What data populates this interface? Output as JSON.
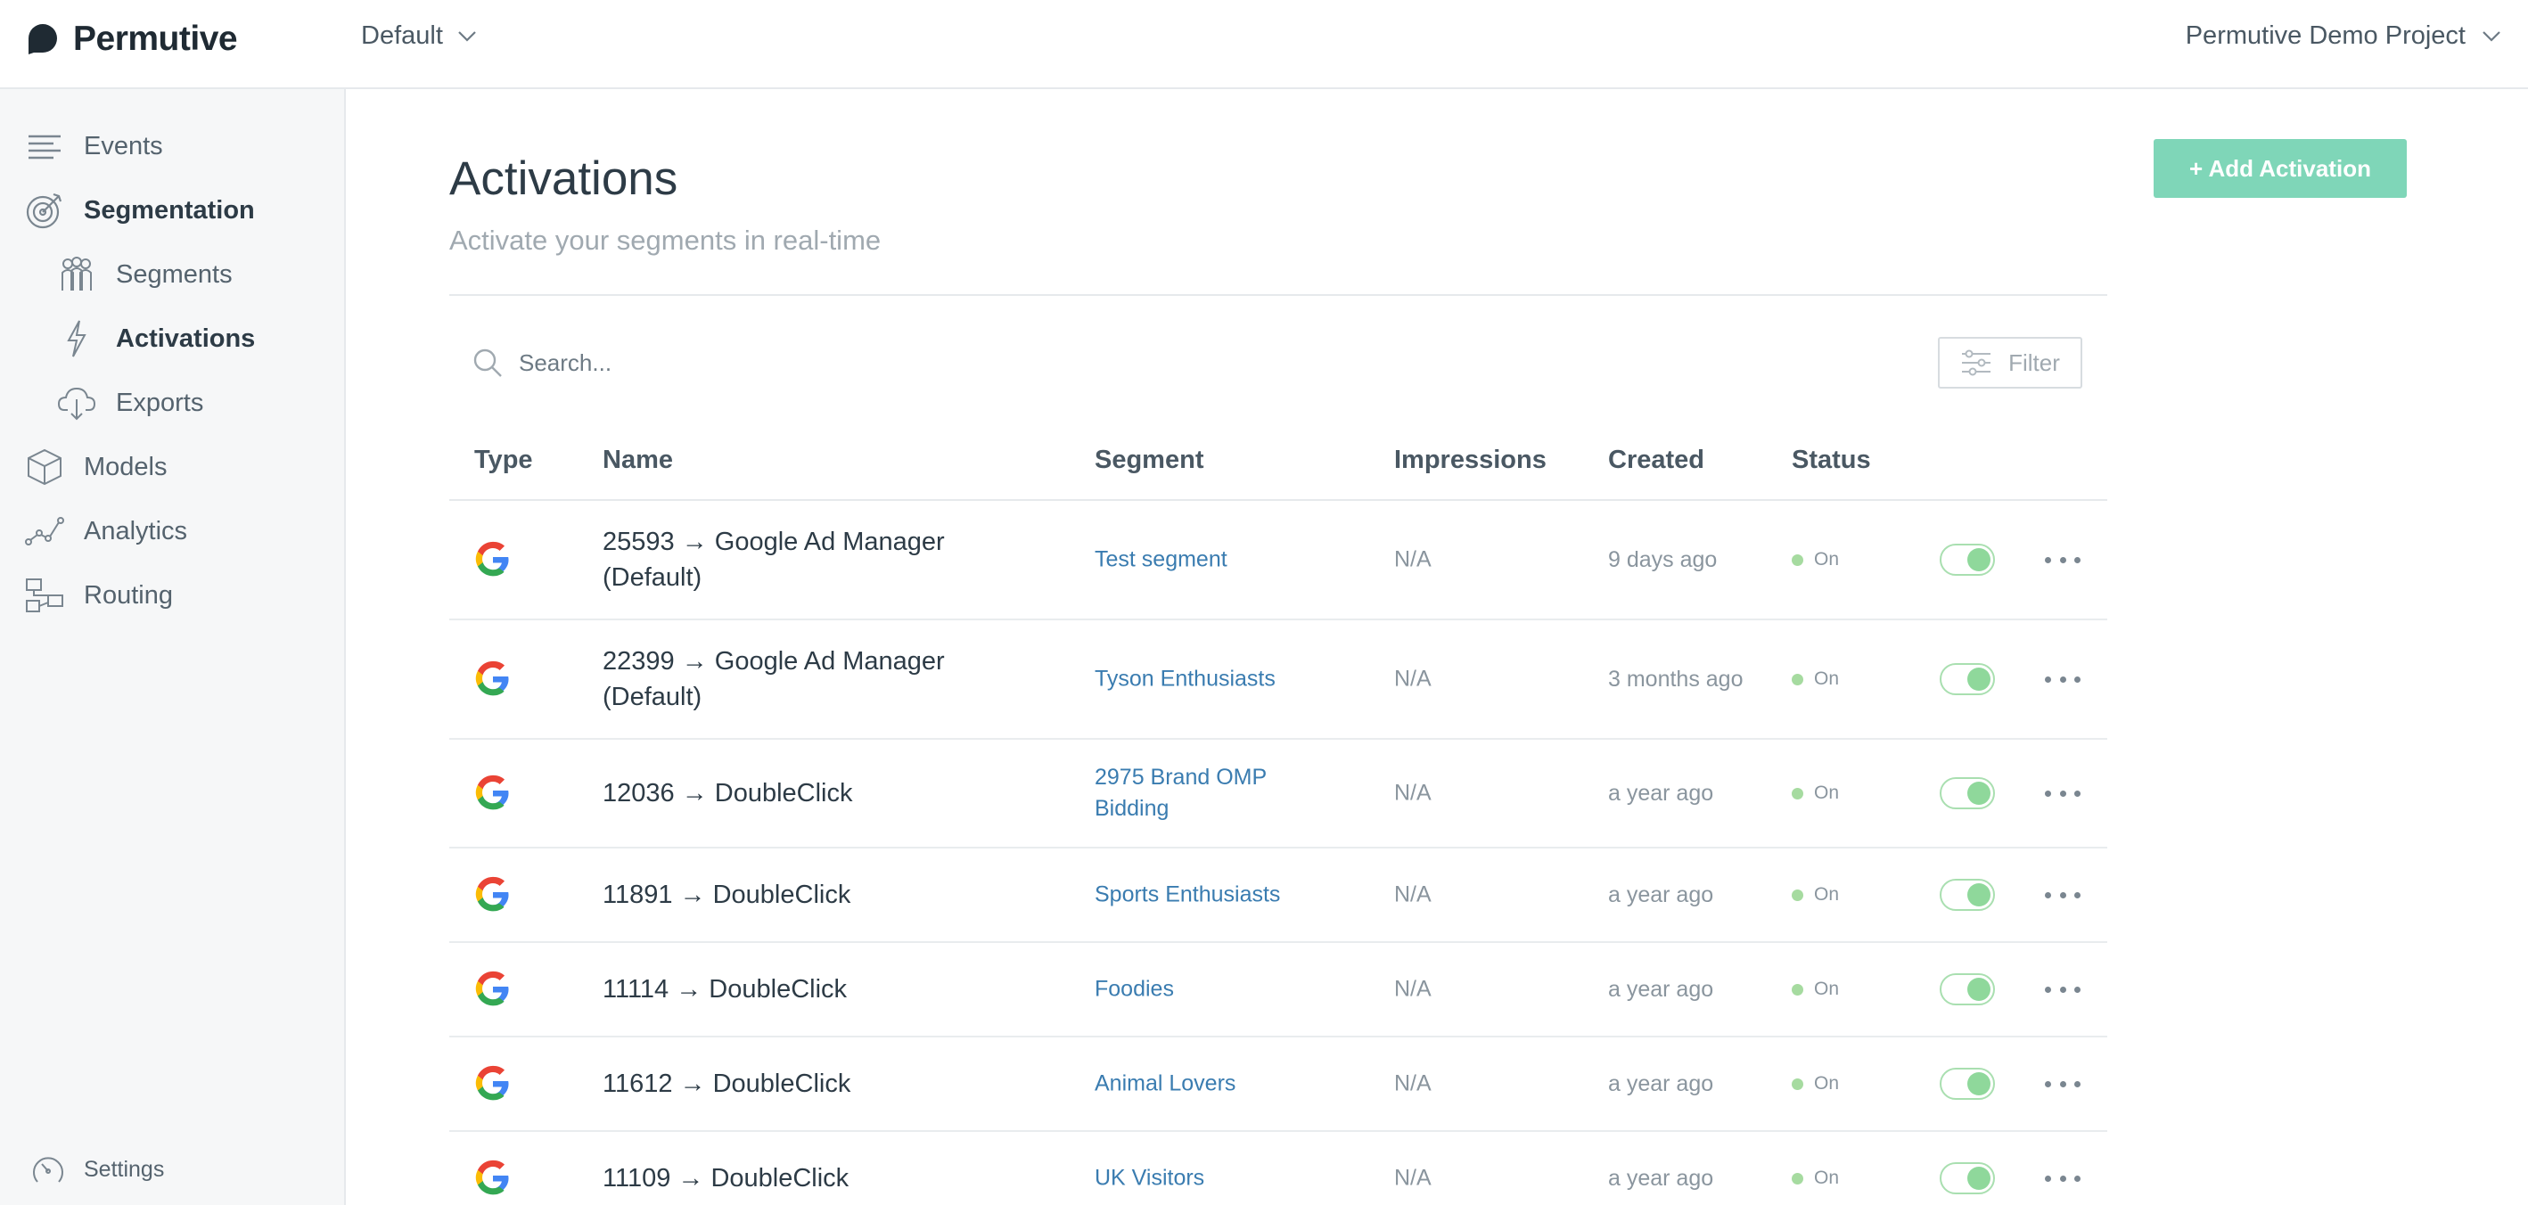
{
  "header": {
    "logo_text": "Permutive",
    "workspace": "Default",
    "project": "Permutive Demo Project"
  },
  "sidebar": {
    "items": [
      {
        "label": "Events",
        "icon": "events-icon"
      },
      {
        "label": "Segmentation",
        "icon": "target-icon"
      },
      {
        "label": "Segments",
        "icon": "segments-icon"
      },
      {
        "label": "Activations",
        "icon": "lightning-icon"
      },
      {
        "label": "Exports",
        "icon": "cloud-download-icon"
      },
      {
        "label": "Models",
        "icon": "cube-icon"
      },
      {
        "label": "Analytics",
        "icon": "analytics-icon"
      },
      {
        "label": "Routing",
        "icon": "routing-icon"
      }
    ],
    "settings_label": "Settings"
  },
  "main": {
    "title": "Activations",
    "subtitle": "Activate your segments in real-time",
    "add_button": "+ Add Activation",
    "search_placeholder": "Search...",
    "filter_label": "Filter"
  },
  "table": {
    "columns": [
      "Type",
      "Name",
      "Segment",
      "Impressions",
      "Created",
      "Status"
    ],
    "rows": [
      {
        "name": "25593 → Google Ad Manager (Default)",
        "segment": "Test segment",
        "impressions": "N/A",
        "created": "9 days ago",
        "status": "On"
      },
      {
        "name": "22399 → Google Ad Manager (Default)",
        "segment": "Tyson Enthusiasts",
        "impressions": "N/A",
        "created": "3 months ago",
        "status": "On"
      },
      {
        "name": "12036 → DoubleClick",
        "segment": "2975 Brand OMP Bidding",
        "impressions": "N/A",
        "created": "a year ago",
        "status": "On"
      },
      {
        "name": "11891 → DoubleClick",
        "segment": "Sports Enthusiasts",
        "impressions": "N/A",
        "created": "a year ago",
        "status": "On"
      },
      {
        "name": "11114 → DoubleClick",
        "segment": "Foodies",
        "impressions": "N/A",
        "created": "a year ago",
        "status": "On"
      },
      {
        "name": "11612 → DoubleClick",
        "segment": "Animal Lovers",
        "impressions": "N/A",
        "created": "a year ago",
        "status": "On"
      },
      {
        "name": "11109 → DoubleClick",
        "segment": "UK Visitors",
        "impressions": "N/A",
        "created": "a year ago",
        "status": "On"
      }
    ]
  },
  "colors": {
    "accent": "#7fd6b8",
    "link": "#3a7cb0",
    "status_on": "#a6dba0"
  }
}
